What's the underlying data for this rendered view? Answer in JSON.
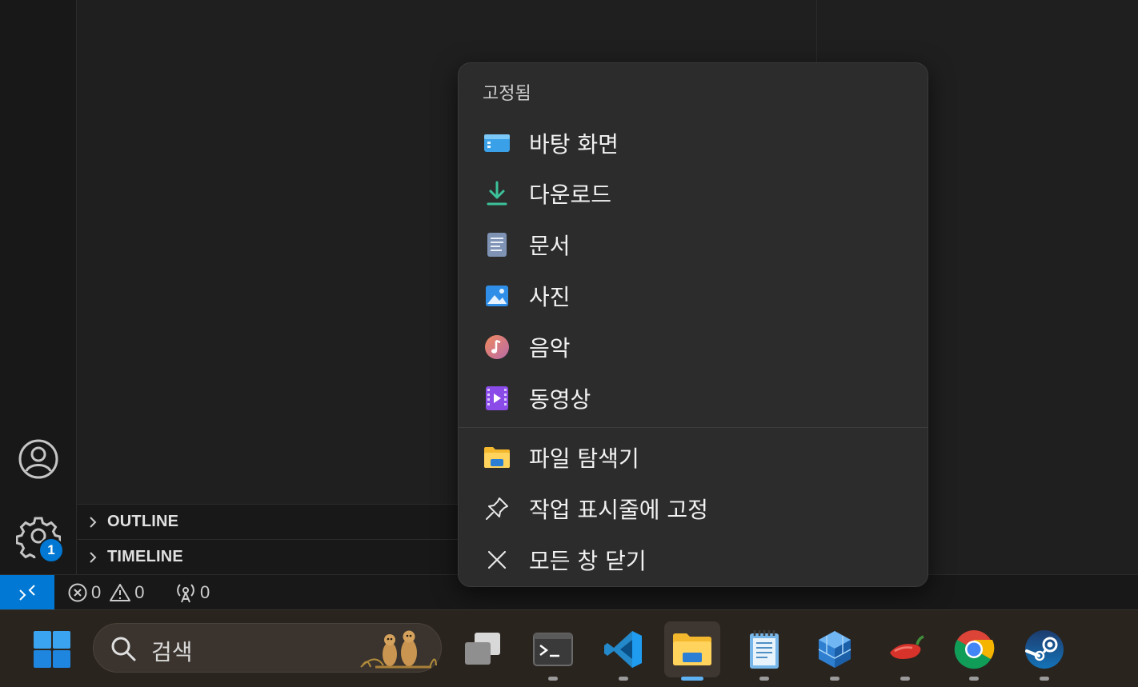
{
  "sidebar": {
    "sections": [
      {
        "label": "OUTLINE"
      },
      {
        "label": "TIMELINE"
      }
    ],
    "settings_badge": "1"
  },
  "statusbar": {
    "errors": "0",
    "warnings": "0",
    "ports": "0"
  },
  "jumplist": {
    "header": "고정됨",
    "pinned": [
      {
        "label": "바탕 화면",
        "icon": "desktop-folder-icon"
      },
      {
        "label": "다운로드",
        "icon": "downloads-icon"
      },
      {
        "label": "문서",
        "icon": "documents-icon"
      },
      {
        "label": "사진",
        "icon": "pictures-icon"
      },
      {
        "label": "음악",
        "icon": "music-icon"
      },
      {
        "label": "동영상",
        "icon": "videos-icon"
      }
    ],
    "actions": [
      {
        "label": "파일 탐색기",
        "icon": "file-explorer-icon"
      },
      {
        "label": "작업 표시줄에 고정",
        "icon": "pin-icon"
      },
      {
        "label": "모든 창 닫기",
        "icon": "close-icon"
      }
    ]
  },
  "taskbar": {
    "search_placeholder": "검색",
    "apps": [
      "task-view",
      "terminal",
      "vscode",
      "file-explorer",
      "notepad",
      "app-cube",
      "pepper-app",
      "chrome",
      "steam"
    ]
  },
  "colors": {
    "accent": "#0078d4",
    "menu_bg": "#2c2c2c",
    "taskbar_bg": "#2a241f"
  }
}
